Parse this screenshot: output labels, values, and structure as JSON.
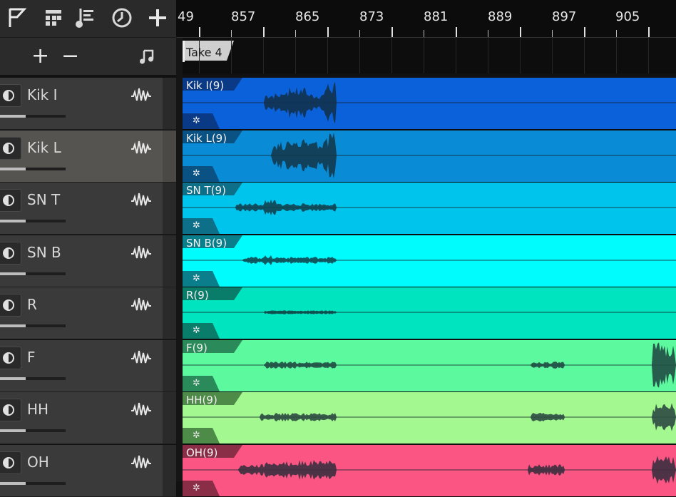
{
  "toolbar": {
    "icons": [
      "flag-icon",
      "grid-snap-icon",
      "step-sequencer-icon",
      "clock-icon",
      "add-icon"
    ]
  },
  "subbar": {
    "add_label": "+",
    "remove_label": "−",
    "note_icon": "music-note-icon"
  },
  "ruler": {
    "ticks": [
      "49",
      "857",
      "865",
      "873",
      "881",
      "889",
      "897",
      "905"
    ]
  },
  "take": {
    "label": "Take 4"
  },
  "colors": {
    "ruler_bg": "#0c0c0c",
    "header_bg": "#3a3a3a",
    "header_selected_bg": "#555450"
  },
  "tracks": [
    {
      "name": "Kik I",
      "clip": "Kik I(9)",
      "color": "#0b61d9",
      "tab": "#0a3a86",
      "selected": false
    },
    {
      "name": "Kik L",
      "clip": "Kik L(9)",
      "color": "#0a8bd6",
      "tab": "#0a5283",
      "selected": true
    },
    {
      "name": "SN T",
      "clip": "SN T(9)",
      "color": "#00c4ec",
      "tab": "#0d6f88",
      "selected": false
    },
    {
      "name": "SN B",
      "clip": "SN B(9)",
      "color": "#00fcfc",
      "tab": "#0a7e8a",
      "selected": false
    },
    {
      "name": "R",
      "clip": "R(9)",
      "color": "#00e4c0",
      "tab": "#0a7c6a",
      "selected": false
    },
    {
      "name": "F",
      "clip": "F(9)",
      "color": "#5cf99e",
      "tab": "#2a8a5a",
      "selected": false
    },
    {
      "name": "HH",
      "clip": "HH(9)",
      "color": "#a3f890",
      "tab": "#4e8a48",
      "selected": false
    },
    {
      "name": "OH",
      "clip": "OH(9)",
      "color": "#fb5584",
      "tab": "#8a2e48",
      "selected": false
    }
  ]
}
